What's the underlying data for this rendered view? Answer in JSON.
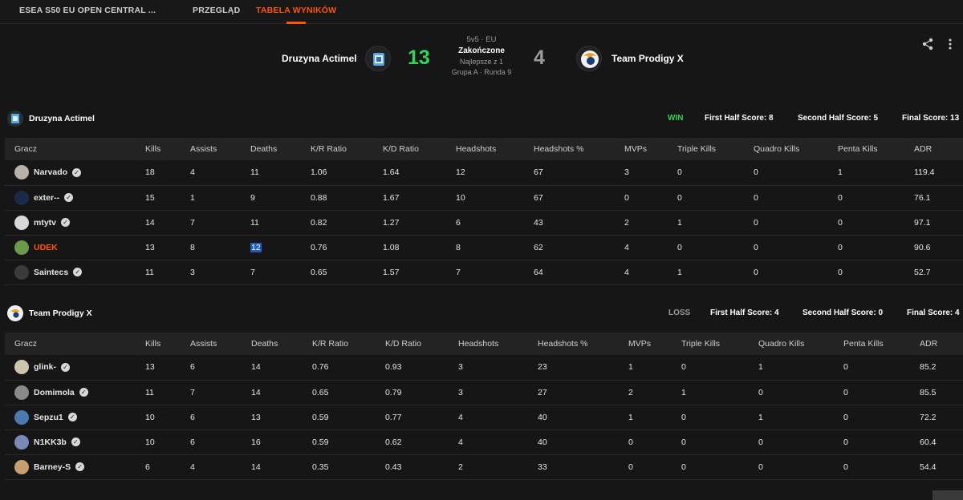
{
  "nav": {
    "tabs": [
      {
        "label": "ESEA S50 EU OPEN CENTRAL ..."
      },
      {
        "label": "PRZEGLĄD"
      },
      {
        "label": "TABELA WYNIKÓW"
      }
    ],
    "active_tab": 2
  },
  "match": {
    "team1": {
      "name": "Druzyna Actimel",
      "score": "13"
    },
    "team2": {
      "name": "Team Prodigy X",
      "score": "4"
    },
    "format": "5v5 · EU",
    "status": "Zakończone",
    "best_of": "Najlepsze z 1",
    "round": "Grupa A · Runda 9"
  },
  "icons": {
    "share": "share-icon",
    "more": "more-vertical-icon"
  },
  "colors": {
    "accent": "#ff5500",
    "win": "#32d35a",
    "loss": "#9a9a9a"
  },
  "team1": {
    "name": "Druzyna Actimel",
    "result": "WIN",
    "first_half": "First Half Score: 8",
    "second_half": "Second Half Score: 5",
    "final": "Final Score: 13",
    "columns": [
      "Gracz",
      "Kills",
      "Assists",
      "Deaths",
      "K/R Ratio",
      "K/D Ratio",
      "Headshots",
      "Headshots %",
      "MVPs",
      "Triple Kills",
      "Quadro Kills",
      "Penta Kills",
      "ADR"
    ],
    "rows": [
      {
        "player": "Narvado",
        "kills": "18",
        "assists": "4",
        "deaths": "11",
        "kr": "1.06",
        "kd": "1.64",
        "hs": "12",
        "hsp": "67",
        "mvps": "3",
        "triple": "0",
        "quadro": "0",
        "penta": "1",
        "adr": "119.4"
      },
      {
        "player": "exter--",
        "kills": "15",
        "assists": "1",
        "deaths": "9",
        "kr": "0.88",
        "kd": "1.67",
        "hs": "10",
        "hsp": "67",
        "mvps": "0",
        "triple": "0",
        "quadro": "0",
        "penta": "0",
        "adr": "76.1"
      },
      {
        "player": "mtytv",
        "kills": "14",
        "assists": "7",
        "deaths": "11",
        "kr": "0.82",
        "kd": "1.27",
        "hs": "6",
        "hsp": "43",
        "mvps": "2",
        "triple": "1",
        "quadro": "0",
        "penta": "0",
        "adr": "97.1"
      },
      {
        "player": "UDEK",
        "kills": "13",
        "assists": "8",
        "deaths": "12",
        "kr": "0.76",
        "kd": "1.08",
        "hs": "8",
        "hsp": "62",
        "mvps": "4",
        "triple": "0",
        "quadro": "0",
        "penta": "0",
        "adr": "90.6"
      },
      {
        "player": "Saintecs",
        "kills": "11",
        "assists": "3",
        "deaths": "7",
        "kr": "0.65",
        "kd": "1.57",
        "hs": "7",
        "hsp": "64",
        "mvps": "4",
        "triple": "1",
        "quadro": "0",
        "penta": "0",
        "adr": "52.7"
      }
    ]
  },
  "team2": {
    "name": "Team Prodigy X",
    "result": "LOSS",
    "first_half": "First Half Score: 4",
    "second_half": "Second Half Score: 0",
    "final": "Final Score: 4",
    "columns": [
      "Gracz",
      "Kills",
      "Assists",
      "Deaths",
      "K/R Ratio",
      "K/D Ratio",
      "Headshots",
      "Headshots %",
      "MVPs",
      "Triple Kills",
      "Quadro Kills",
      "Penta Kills",
      "ADR"
    ],
    "rows": [
      {
        "player": "glink-",
        "kills": "13",
        "assists": "6",
        "deaths": "14",
        "kr": "0.76",
        "kd": "0.93",
        "hs": "3",
        "hsp": "23",
        "mvps": "1",
        "triple": "0",
        "quadro": "1",
        "penta": "0",
        "adr": "85.2"
      },
      {
        "player": "Domimola",
        "kills": "11",
        "assists": "7",
        "deaths": "14",
        "kr": "0.65",
        "kd": "0.79",
        "hs": "3",
        "hsp": "27",
        "mvps": "2",
        "triple": "1",
        "quadro": "0",
        "penta": "0",
        "adr": "85.5"
      },
      {
        "player": "Sepzu1",
        "kills": "10",
        "assists": "6",
        "deaths": "13",
        "kr": "0.59",
        "kd": "0.77",
        "hs": "4",
        "hsp": "40",
        "mvps": "1",
        "triple": "0",
        "quadro": "1",
        "penta": "0",
        "adr": "72.2"
      },
      {
        "player": "N1KK3b",
        "kills": "10",
        "assists": "6",
        "deaths": "16",
        "kr": "0.59",
        "kd": "0.62",
        "hs": "4",
        "hsp": "40",
        "mvps": "0",
        "triple": "0",
        "quadro": "0",
        "penta": "0",
        "adr": "60.4"
      },
      {
        "player": "Barney-S",
        "kills": "6",
        "assists": "4",
        "deaths": "14",
        "kr": "0.35",
        "kd": "0.43",
        "hs": "2",
        "hsp": "33",
        "mvps": "0",
        "triple": "0",
        "quadro": "0",
        "penta": "0",
        "adr": "54.4"
      }
    ]
  }
}
